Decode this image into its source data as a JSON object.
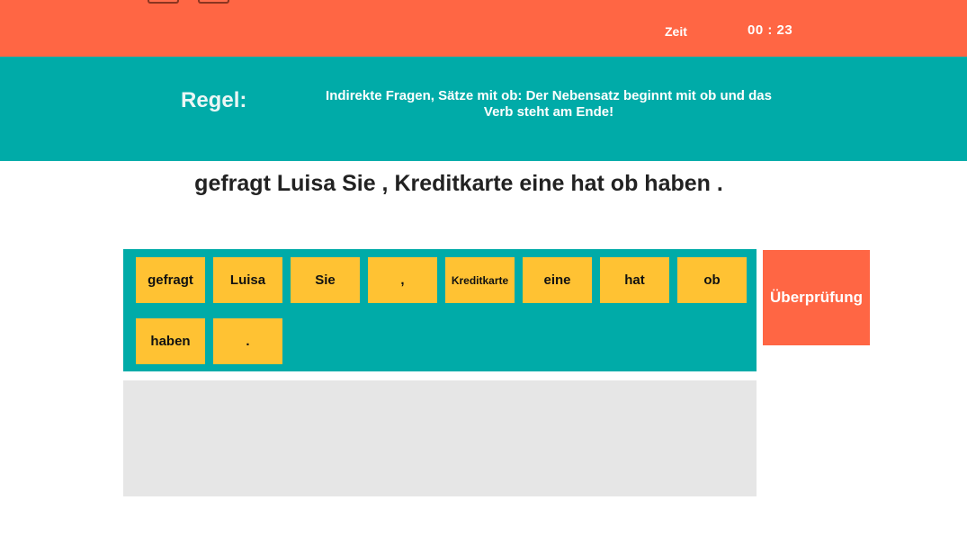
{
  "header": {
    "timer_label": "Zeit",
    "timer_value": "00 : 23",
    "icons": [
      "menu-icon",
      "sound-icon"
    ]
  },
  "rule": {
    "title": "Regel:",
    "text": "Indirekte Fragen, Sätze mit ob: Der Nebensatz beginnt mit ob und das Verb steht am Ende!"
  },
  "sentence": "gefragt Luisa Sie , Kreditkarte eine hat ob haben .",
  "tiles": [
    "gefragt",
    "Luisa",
    "Sie",
    ",",
    "Kreditkarte",
    "eine",
    "hat",
    "ob",
    "haben",
    "."
  ],
  "check_button_label": "Überprüfung",
  "colors": {
    "header": "#ff6644",
    "rule_bar": "#00aba8",
    "tile": "#ffc233",
    "drop_area": "#e6e6e6"
  }
}
